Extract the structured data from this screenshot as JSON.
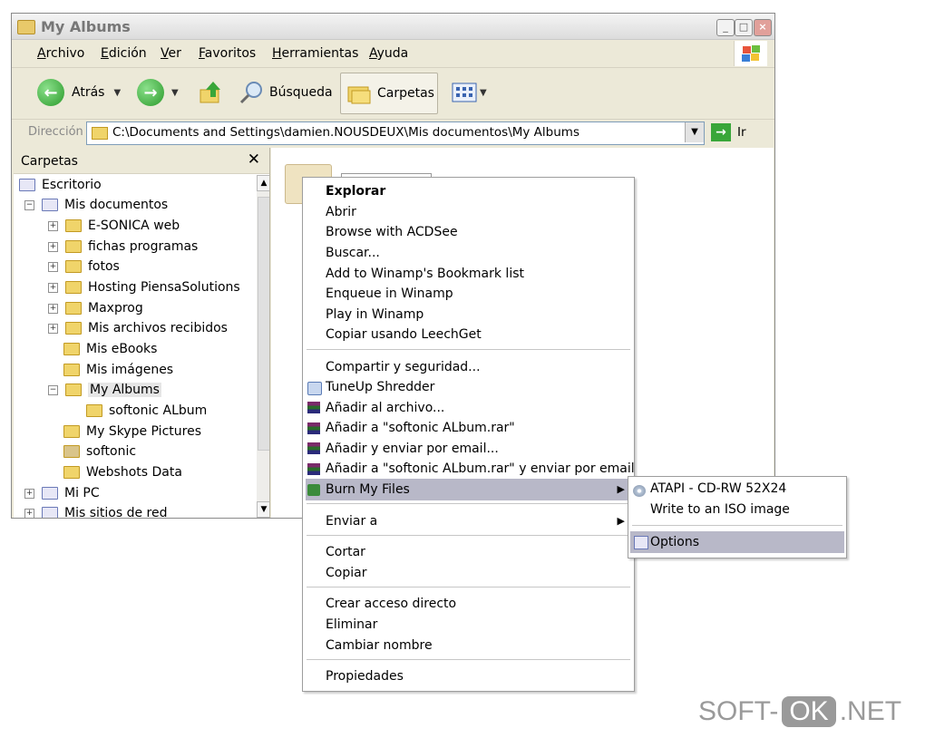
{
  "window": {
    "title": "My Albums"
  },
  "menubar": [
    "Archivo",
    "Edición",
    "Ver",
    "Favoritos",
    "Herramientas",
    "Ayuda"
  ],
  "toolbar": {
    "back": "Atrás",
    "search": "Búsqueda",
    "folders": "Carpetas"
  },
  "address": {
    "label": "Dirección",
    "path": "C:\\Documents and Settings\\damien.NOUSDEUX\\Mis documentos\\My Albums",
    "go": "Ir"
  },
  "folders_pane": {
    "title": "Carpetas",
    "tree": [
      {
        "label": "Escritorio"
      },
      {
        "label": "Mis documentos"
      },
      {
        "label": "E-SONICA web"
      },
      {
        "label": "fichas programas"
      },
      {
        "label": "fotos"
      },
      {
        "label": "Hosting PiensaSolutions"
      },
      {
        "label": "Maxprog"
      },
      {
        "label": "Mis archivos recibidos"
      },
      {
        "label": "Mis eBooks"
      },
      {
        "label": "Mis imágenes"
      },
      {
        "label": "My Albums"
      },
      {
        "label": "softonic ALbum"
      },
      {
        "label": "My Skype Pictures"
      },
      {
        "label": "softonic"
      },
      {
        "label": "Webshots Data"
      },
      {
        "label": "Mi PC"
      },
      {
        "label": "Mis sitios de red"
      }
    ]
  },
  "context_menu": {
    "items": [
      "Explorar",
      "Abrir",
      "Browse with ACDSee",
      "Buscar...",
      "Add to Winamp's Bookmark list",
      "Enqueue in Winamp",
      "Play in Winamp",
      "Copiar usando LeechGet",
      "Compartir y seguridad...",
      "TuneUp Shredder",
      "Añadir al archivo...",
      "Añadir a \"softonic ALbum.rar\"",
      "Añadir y enviar por email...",
      "Añadir a \"softonic ALbum.rar\" y enviar por email",
      "Burn My Files",
      "Enviar a",
      "Cortar",
      "Copiar",
      "Crear acceso directo",
      "Eliminar",
      "Cambiar nombre",
      "Propiedades"
    ]
  },
  "submenu": {
    "items": [
      "ATAPI    -  CD-RW 52X24",
      "Write to an ISO image",
      "Options"
    ]
  },
  "watermark": {
    "left": "SOFT-",
    "ok": "OK",
    "right": ".NET"
  }
}
